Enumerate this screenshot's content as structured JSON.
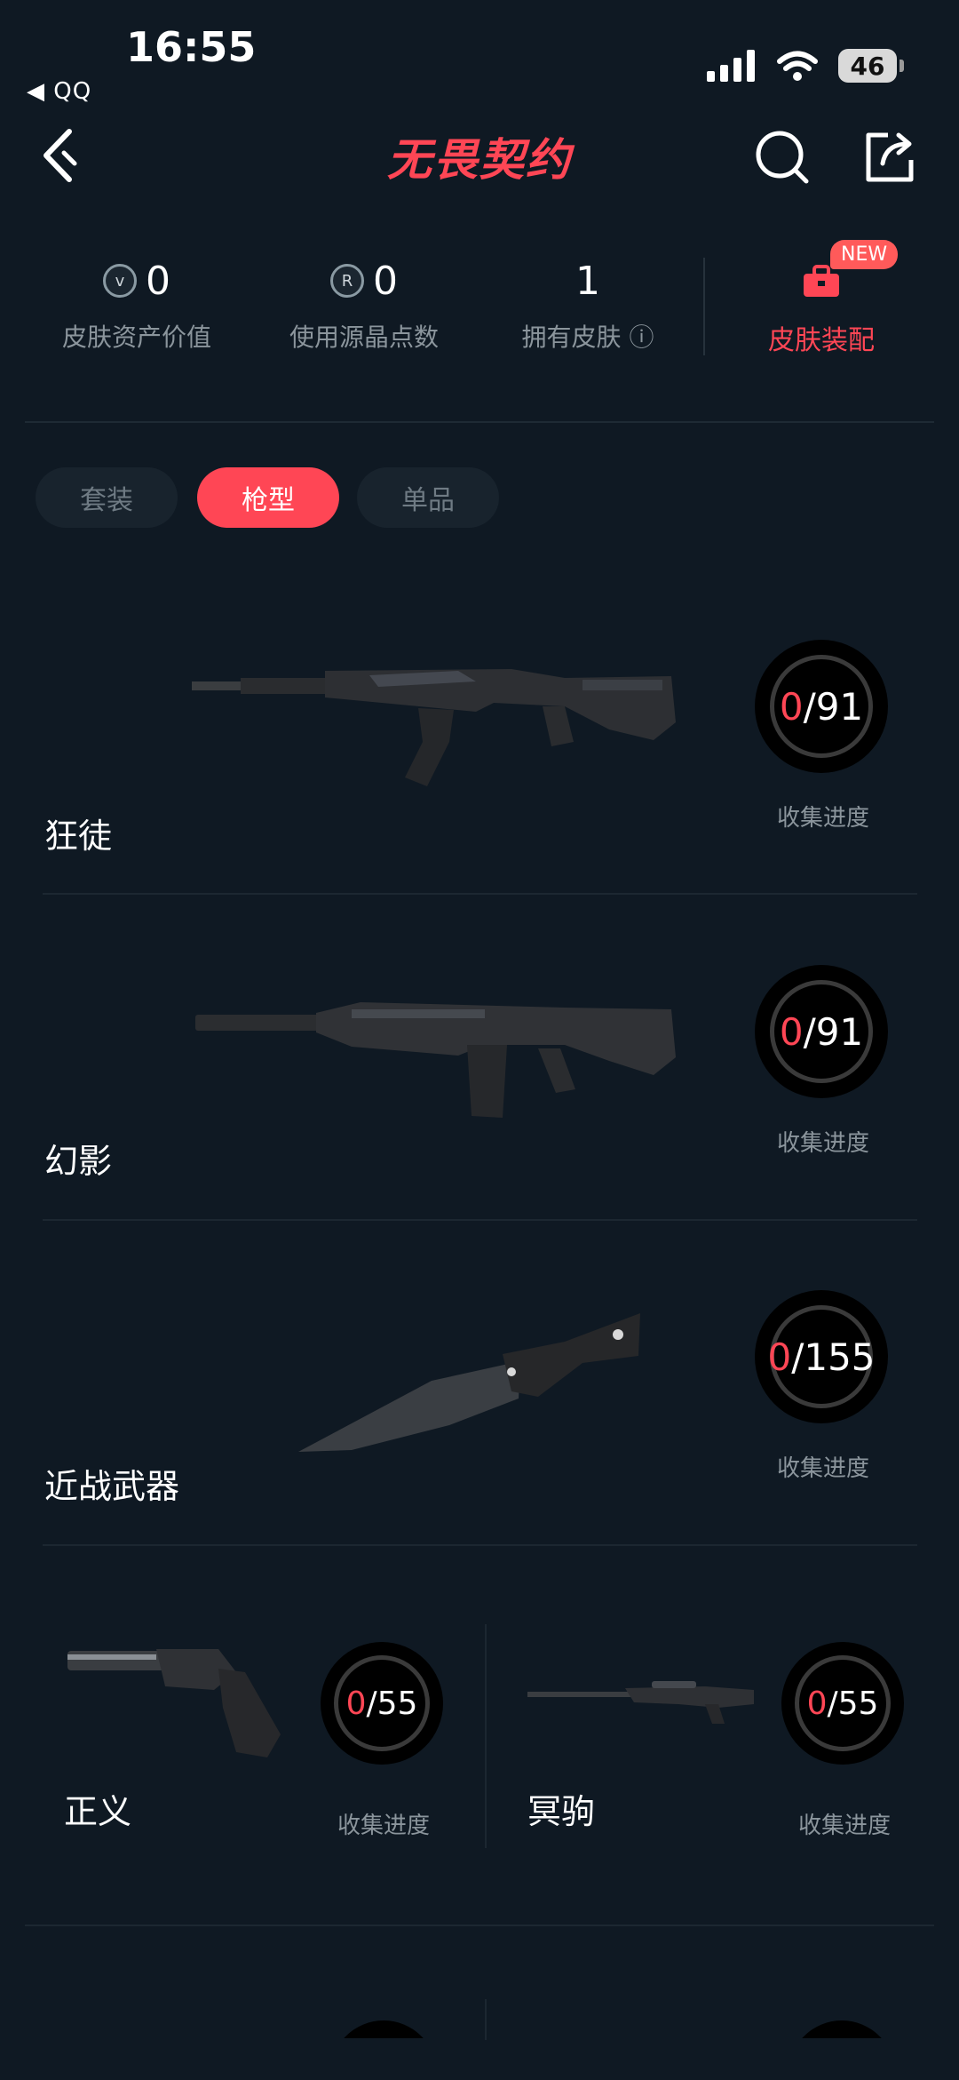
{
  "status": {
    "time": "16:55",
    "back_app": "◀ QQ",
    "battery": "46"
  },
  "header": {
    "title": "无畏契约"
  },
  "stats": [
    {
      "value": "0",
      "label": "皮肤资产价值",
      "icon": "v"
    },
    {
      "value": "0",
      "label": "使用源晶点数",
      "icon": "R"
    },
    {
      "value": "1",
      "label": "拥有皮肤 ⓘ"
    }
  ],
  "equip": {
    "badge": "NEW",
    "label": "皮肤装配"
  },
  "tabs": [
    {
      "label": "套装"
    },
    {
      "label": "枪型"
    },
    {
      "label": "单品"
    }
  ],
  "progress_label": "收集进度",
  "weapons": [
    {
      "name": "狂徒",
      "owned": "0",
      "total": "/91"
    },
    {
      "name": "幻影",
      "owned": "0",
      "total": "/91"
    },
    {
      "name": "近战武器",
      "owned": "0",
      "total": "/155"
    },
    {
      "name": "正义",
      "owned": "0",
      "total": "/55"
    },
    {
      "name": "冥驹",
      "owned": "0",
      "total": "/55"
    }
  ],
  "colors": {
    "accent": "#ff4655",
    "background": "#0f1923"
  }
}
